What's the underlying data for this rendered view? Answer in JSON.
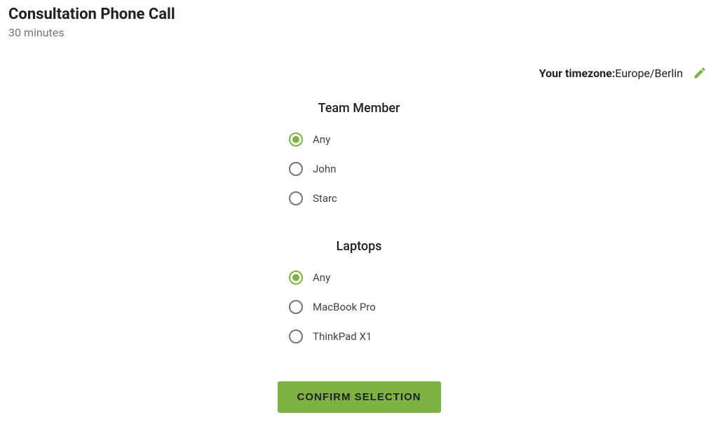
{
  "header": {
    "title": "Consultation Phone Call",
    "duration": "30 minutes"
  },
  "timezone": {
    "label": "Your timezone:",
    "value": "Europe/Berlin"
  },
  "groups": [
    {
      "heading": "Team Member",
      "options": [
        {
          "label": "Any",
          "selected": true
        },
        {
          "label": "John",
          "selected": false
        },
        {
          "label": "Starc",
          "selected": false
        }
      ]
    },
    {
      "heading": "Laptops",
      "options": [
        {
          "label": "Any",
          "selected": true
        },
        {
          "label": "MacBook Pro",
          "selected": false
        },
        {
          "label": "ThinkPad X1",
          "selected": false
        }
      ]
    }
  ],
  "confirm_label": "CONFIRM SELECTION",
  "colors": {
    "accent": "#7cb342"
  }
}
